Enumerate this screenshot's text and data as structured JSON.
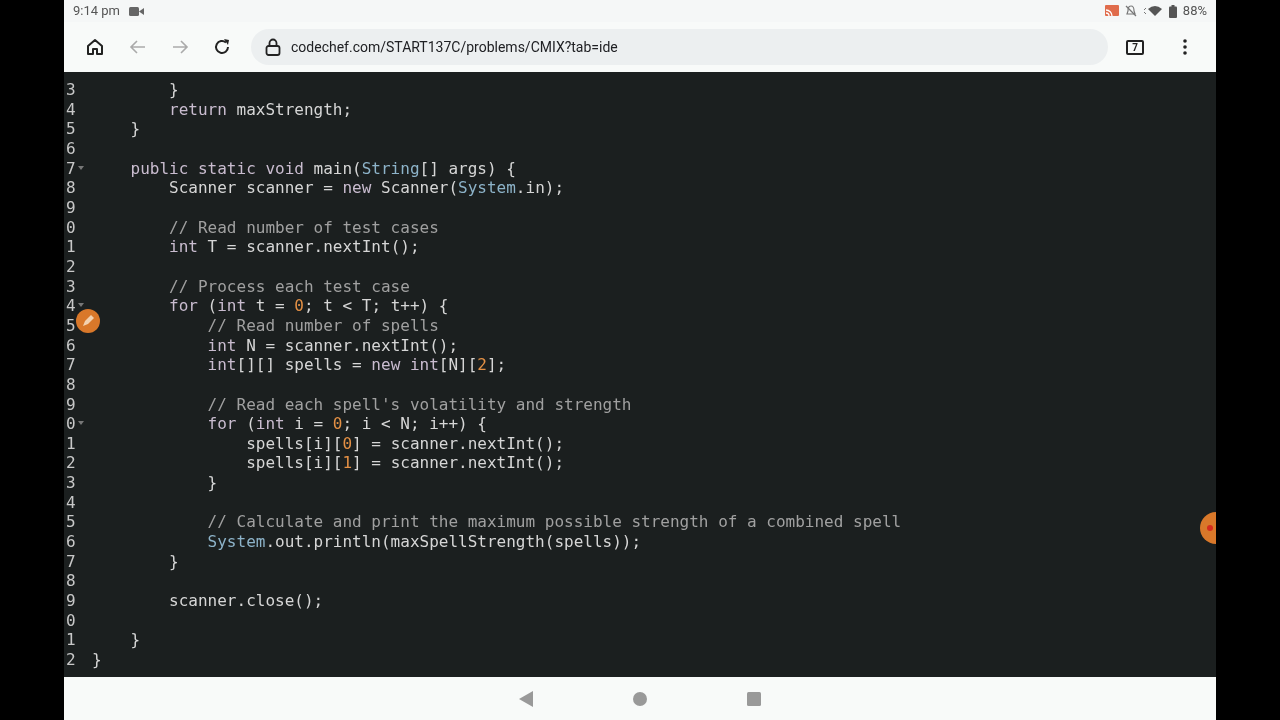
{
  "status_bar": {
    "time": "9:14 pm",
    "battery": "88%"
  },
  "browser": {
    "back_disabled": true,
    "forward_disabled": true,
    "url": "codechef.com/START137C/problems/CMIX?tab=ide",
    "tab_count": "7"
  },
  "editor": {
    "lines": [
      {
        "num": "3",
        "tokens": [
          {
            "kind": "plain",
            "t": "        }"
          }
        ]
      },
      {
        "num": "4",
        "tokens": [
          {
            "kind": "kw",
            "t": "        return"
          },
          {
            "kind": "plain",
            "t": " maxStrength;"
          }
        ]
      },
      {
        "num": "5",
        "tokens": [
          {
            "kind": "plain",
            "t": "    }"
          }
        ]
      },
      {
        "num": "6"
      },
      {
        "num": "7",
        "fold": true,
        "tokens": [
          {
            "kind": "kw",
            "t": "    public static void"
          },
          {
            "kind": "plain",
            "t": " main("
          },
          {
            "kind": "type",
            "t": "String"
          },
          {
            "kind": "plain",
            "t": "[] args) {"
          }
        ]
      },
      {
        "num": "8",
        "tokens": [
          {
            "kind": "plain",
            "t": "        Scanner scanner = "
          },
          {
            "kind": "kw",
            "t": "new"
          },
          {
            "kind": "plain",
            "t": " Scanner("
          },
          {
            "kind": "type",
            "t": "System"
          },
          {
            "kind": "plain",
            "t": ".in);"
          }
        ]
      },
      {
        "num": "9"
      },
      {
        "num": "0",
        "tokens": [
          {
            "kind": "comment",
            "t": "        // Read number of test cases"
          }
        ]
      },
      {
        "num": "1",
        "tokens": [
          {
            "kind": "kw",
            "t": "        int"
          },
          {
            "kind": "plain",
            "t": " T = scanner.nextInt();"
          }
        ]
      },
      {
        "num": "2"
      },
      {
        "num": "3",
        "tokens": [
          {
            "kind": "comment",
            "t": "        // Process each test case"
          }
        ]
      },
      {
        "num": "4",
        "fold": true,
        "tokens": [
          {
            "kind": "kw",
            "t": "        for"
          },
          {
            "kind": "plain",
            "t": " ("
          },
          {
            "kind": "kw",
            "t": "int"
          },
          {
            "kind": "plain",
            "t": " t = "
          },
          {
            "kind": "num",
            "t": "0"
          },
          {
            "kind": "plain",
            "t": "; t < T; t++) {"
          }
        ]
      },
      {
        "num": "5",
        "tokens": [
          {
            "kind": "comment",
            "t": "            // Read number of spells"
          }
        ]
      },
      {
        "num": "6",
        "tokens": [
          {
            "kind": "kw",
            "t": "            int"
          },
          {
            "kind": "plain",
            "t": " N = scanner.nextInt();"
          }
        ]
      },
      {
        "num": "7",
        "tokens": [
          {
            "kind": "kw",
            "t": "            int"
          },
          {
            "kind": "plain",
            "t": "[][] spells = "
          },
          {
            "kind": "kw",
            "t": "new int"
          },
          {
            "kind": "plain",
            "t": "[N]["
          },
          {
            "kind": "num",
            "t": "2"
          },
          {
            "kind": "plain",
            "t": "];"
          }
        ]
      },
      {
        "num": "8"
      },
      {
        "num": "9",
        "tokens": [
          {
            "kind": "comment",
            "t": "            // Read each spell's volatility and strength"
          }
        ]
      },
      {
        "num": "0",
        "fold": true,
        "tokens": [
          {
            "kind": "kw",
            "t": "            for"
          },
          {
            "kind": "plain",
            "t": " ("
          },
          {
            "kind": "kw",
            "t": "int"
          },
          {
            "kind": "plain",
            "t": " i = "
          },
          {
            "kind": "num",
            "t": "0"
          },
          {
            "kind": "plain",
            "t": "; i < N; i++) {"
          }
        ]
      },
      {
        "num": "1",
        "tokens": [
          {
            "kind": "plain",
            "t": "                spells[i]["
          },
          {
            "kind": "num",
            "t": "0"
          },
          {
            "kind": "plain",
            "t": "] = scanner.nextInt();"
          }
        ]
      },
      {
        "num": "2",
        "tokens": [
          {
            "kind": "plain",
            "t": "                spells[i]["
          },
          {
            "kind": "num",
            "t": "1"
          },
          {
            "kind": "plain",
            "t": "] = scanner.nextInt();"
          }
        ]
      },
      {
        "num": "3",
        "tokens": [
          {
            "kind": "plain",
            "t": "            }"
          }
        ]
      },
      {
        "num": "4"
      },
      {
        "num": "5",
        "tokens": [
          {
            "kind": "comment",
            "t": "            // Calculate and print the maximum possible strength of a combined spell"
          }
        ]
      },
      {
        "num": "6",
        "tokens": [
          {
            "kind": "type",
            "t": "            System"
          },
          {
            "kind": "plain",
            "t": ".out.println(maxSpellStrength(spells));"
          }
        ]
      },
      {
        "num": "7",
        "tokens": [
          {
            "kind": "plain",
            "t": "        }"
          }
        ]
      },
      {
        "num": "8"
      },
      {
        "num": "9",
        "tokens": [
          {
            "kind": "plain",
            "t": "        scanner.close();"
          }
        ]
      },
      {
        "num": "0"
      },
      {
        "num": "1",
        "tokens": [
          {
            "kind": "plain",
            "t": "    }"
          }
        ]
      },
      {
        "num": "2",
        "tokens": [
          {
            "kind": "plain",
            "t": "}"
          }
        ]
      }
    ]
  }
}
